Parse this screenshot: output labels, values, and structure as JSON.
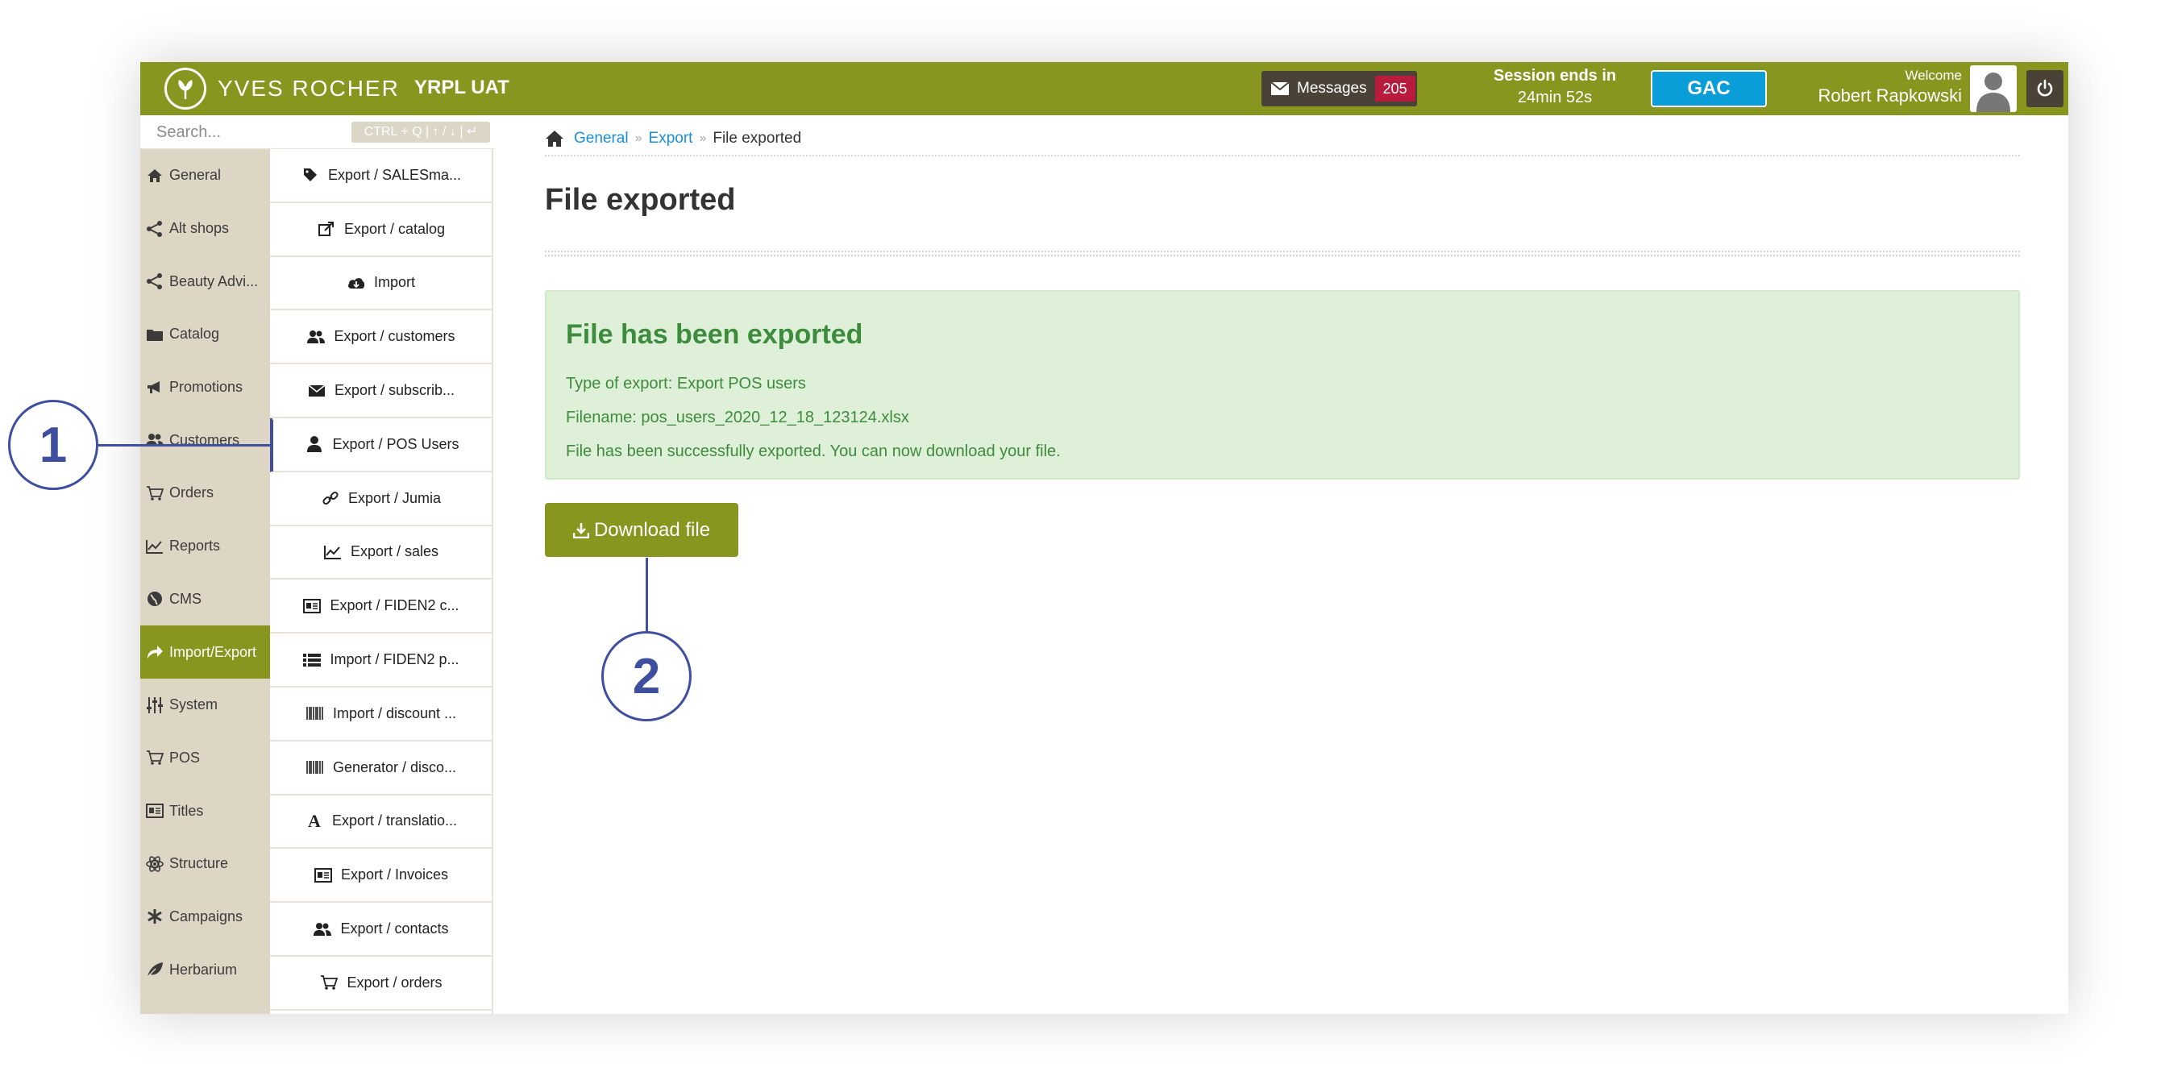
{
  "header": {
    "brand": "YVES ROCHER",
    "environment": "YRPL UAT",
    "messages_label": "Messages",
    "messages_count": "205",
    "session_title": "Session ends in",
    "session_time": "24min 52s",
    "gac_label": "GAC",
    "welcome": "Welcome",
    "user_name": "Robert Rapkowski",
    "colors": {
      "bar": "#88951f",
      "dark": "#4a4237",
      "badge": "#b81b3c",
      "gac": "#0a9ed9"
    }
  },
  "search": {
    "placeholder": "Search...",
    "hint": "CTRL + Q | ↑ / ↓ | ↵"
  },
  "nav": {
    "items": [
      {
        "label": "General",
        "icon": "home-icon"
      },
      {
        "label": "Alt shops",
        "icon": "share-icon"
      },
      {
        "label": "Beauty Advi...",
        "icon": "share-icon"
      },
      {
        "label": "Catalog",
        "icon": "folder-icon"
      },
      {
        "label": "Promotions",
        "icon": "megaphone-icon"
      },
      {
        "label": "Customers",
        "icon": "users-icon"
      },
      {
        "label": "Orders",
        "icon": "cart-icon"
      },
      {
        "label": "Reports",
        "icon": "chart-icon"
      },
      {
        "label": "CMS",
        "icon": "globe-icon"
      },
      {
        "label": "Import/Export",
        "icon": "share-arrow-icon",
        "active": true
      },
      {
        "label": "System",
        "icon": "sliders-icon"
      },
      {
        "label": "POS",
        "icon": "cart-icon"
      },
      {
        "label": "Titles",
        "icon": "id-card-icon"
      },
      {
        "label": "Structure",
        "icon": "atom-icon"
      },
      {
        "label": "Campaigns",
        "icon": "asterisk-icon"
      },
      {
        "label": "Herbarium",
        "icon": "leaf-icon"
      }
    ]
  },
  "subnav": {
    "items": [
      {
        "label": "Export / SALESma...",
        "icon": "tag-icon"
      },
      {
        "label": "Export / catalog",
        "icon": "external-link-icon"
      },
      {
        "label": "Import",
        "icon": "cloud-download-icon"
      },
      {
        "label": "Export / customers",
        "icon": "users-icon"
      },
      {
        "label": "Export / subscrib...",
        "icon": "envelope-icon"
      },
      {
        "label": "Export / POS Users",
        "icon": "user-icon",
        "current": true
      },
      {
        "label": "Export / Jumia",
        "icon": "link-icon"
      },
      {
        "label": "Export / sales",
        "icon": "line-chart-icon"
      },
      {
        "label": "Export / FIDEN2 c...",
        "icon": "id-card-icon"
      },
      {
        "label": "Import / FIDEN2 p...",
        "icon": "list-icon"
      },
      {
        "label": "Import / discount ...",
        "icon": "barcode-icon"
      },
      {
        "label": "Generator / disco...",
        "icon": "barcode-icon"
      },
      {
        "label": "Export / translatio...",
        "icon": "font-icon"
      },
      {
        "label": "Export / Invoices",
        "icon": "id-card-icon"
      },
      {
        "label": "Export / contacts",
        "icon": "users-icon"
      },
      {
        "label": "Export / orders",
        "icon": "cart-icon"
      }
    ]
  },
  "breadcrumb": {
    "items": [
      "General",
      "Export",
      "File exported"
    ]
  },
  "main": {
    "title": "File exported",
    "alert": {
      "heading": "File has been exported",
      "type_line": "Type of export: Export POS users",
      "filename_line": "Filename: pos_users_2020_12_18_123124.xlsx",
      "message": "File has been successfully exported. You can now download your file."
    },
    "download_label": "Download file"
  },
  "callouts": [
    "1",
    "2"
  ]
}
